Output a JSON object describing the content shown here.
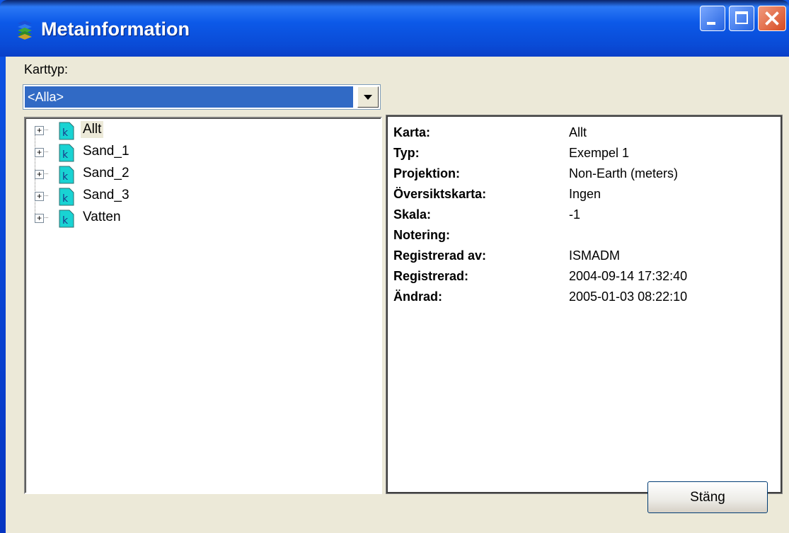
{
  "window": {
    "title": "Metainformation"
  },
  "filter": {
    "label": "Karttyp:",
    "selected": "<Alla>"
  },
  "tree": {
    "items": [
      {
        "label": "Allt"
      },
      {
        "label": "Sand_1"
      },
      {
        "label": "Sand_2"
      },
      {
        "label": "Sand_3"
      },
      {
        "label": "Vatten"
      }
    ],
    "expander_glyph": "+",
    "icon_letter": "k"
  },
  "details": {
    "rows": [
      {
        "key": "Karta:",
        "value": "Allt"
      },
      {
        "key": "Typ:",
        "value": "Exempel 1"
      },
      {
        "key": "Projektion:",
        "value": "Non-Earth (meters)"
      },
      {
        "key": "Översiktskarta:",
        "value": "Ingen"
      },
      {
        "key": "Skala:",
        "value": "-1"
      },
      {
        "key": "Notering:",
        "value": ""
      },
      {
        "key": "Registrerad av:",
        "value": "ISMADM"
      },
      {
        "key": "Registrerad:",
        "value": "2004-09-14 17:32:40"
      },
      {
        "key": "Ändrad:",
        "value": "2005-01-03 08:22:10"
      }
    ]
  },
  "buttons": {
    "close_label": "Stäng"
  },
  "colors": {
    "titlebar": "#0a4bd6",
    "selection": "#316ac5",
    "face": "#ece9d8",
    "close_button": "#d64b22",
    "tree_icon": "#19d3d3"
  },
  "icons": {
    "app": "layers-icon",
    "minimize": "minimize-icon",
    "maximize": "maximize-icon",
    "close": "close-icon",
    "dropdown": "chevron-down-icon",
    "tree_item": "map-document-icon",
    "expander": "plus-box-icon"
  }
}
